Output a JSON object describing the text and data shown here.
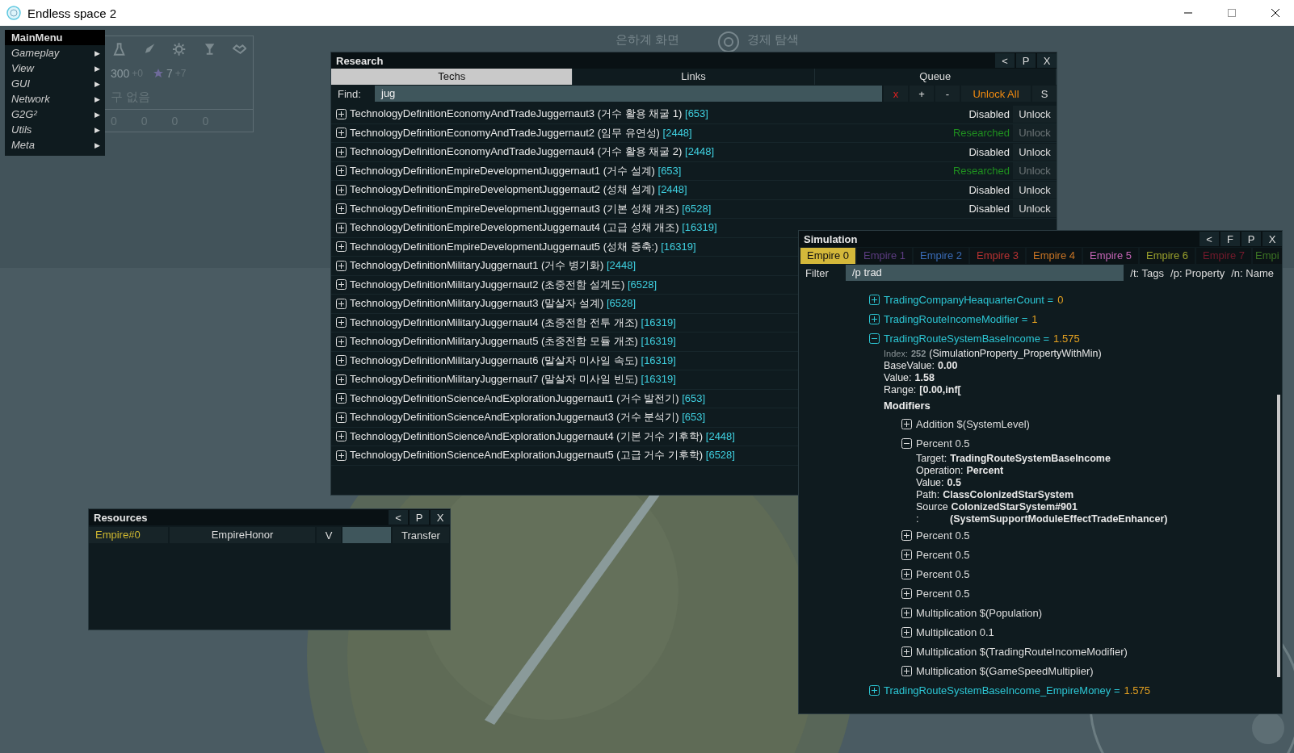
{
  "window": {
    "title": "Endless space 2"
  },
  "game_hud": {
    "tabs": [
      "은하계 화면",
      "경제 탐색"
    ],
    "stats": [
      {
        "value": "300",
        "delta": "+0"
      },
      {
        "value": "7",
        "delta": "+7"
      }
    ],
    "note": "구 없음",
    "counters": [
      "0",
      "0",
      "0",
      "0"
    ]
  },
  "main_menu": {
    "title": "MainMenu",
    "items": [
      {
        "label": "Gameplay",
        "arrow": "▶"
      },
      {
        "label": "View",
        "arrow": "▶"
      },
      {
        "label": "GUI",
        "arrow": "▶"
      },
      {
        "label": "Network",
        "arrow": "▶"
      },
      {
        "label": "G2G²",
        "arrow": "▶"
      },
      {
        "label": "Utils",
        "arrow": "▶"
      },
      {
        "label": "Meta",
        "arrow": "▶"
      }
    ]
  },
  "research": {
    "title": "Research",
    "header_buttons": [
      "<",
      "P",
      "X"
    ],
    "tabs": [
      {
        "label": "Techs",
        "selected": true
      },
      {
        "label": "Links",
        "selected": false
      },
      {
        "label": "Queue",
        "selected": false
      }
    ],
    "find": {
      "label": "Find:",
      "value": "jug",
      "buttons": [
        {
          "label": "x",
          "kind": "clear"
        },
        {
          "label": "+",
          "kind": "plain"
        },
        {
          "label": "-",
          "kind": "plain"
        },
        {
          "label": "Unlock All",
          "kind": "accent"
        },
        {
          "label": "S",
          "kind": "plain"
        }
      ]
    },
    "rows": [
      {
        "name": "TechnologyDefinitionEconomyAndTradeJuggernaut3 (거수 활용 채굴 1)",
        "cost": "[653]",
        "status": "Disabled",
        "researched": false,
        "action": "Unlock"
      },
      {
        "name": "TechnologyDefinitionEconomyAndTradeJuggernaut2 (임무 유연성)",
        "cost": "[2448]",
        "status": "Researched",
        "researched": true,
        "action": "Unlock"
      },
      {
        "name": "TechnologyDefinitionEconomyAndTradeJuggernaut4 (거수 활용 채굴 2)",
        "cost": "[2448]",
        "status": "Disabled",
        "researched": false,
        "action": "Unlock"
      },
      {
        "name": "TechnologyDefinitionEmpireDevelopmentJuggernaut1 (거수 설계)",
        "cost": "[653]",
        "status": "Researched",
        "researched": true,
        "action": "Unlock"
      },
      {
        "name": "TechnologyDefinitionEmpireDevelopmentJuggernaut2 (성채 설계)",
        "cost": "[2448]",
        "status": "Disabled",
        "researched": false,
        "action": "Unlock"
      },
      {
        "name": "TechnologyDefinitionEmpireDevelopmentJuggernaut3 (기본 성채 개조)",
        "cost": "[6528]",
        "status": "Disabled",
        "researched": false,
        "action": "Unlock"
      },
      {
        "name": "TechnologyDefinitionEmpireDevelopmentJuggernaut4 (고급 성채 개조)",
        "cost": "[16319]"
      },
      {
        "name": "TechnologyDefinitionEmpireDevelopmentJuggernaut5 (성채 증축:)",
        "cost": "[16319]"
      },
      {
        "name": "TechnologyDefinitionMilitaryJuggernaut1 (거수 병기화)",
        "cost": "[2448]"
      },
      {
        "name": "TechnologyDefinitionMilitaryJuggernaut2 (초중전함 설계도)",
        "cost": "[6528]"
      },
      {
        "name": "TechnologyDefinitionMilitaryJuggernaut3 (말살자 설계)",
        "cost": "[6528]"
      },
      {
        "name": "TechnologyDefinitionMilitaryJuggernaut4 (초중전함 전투 개조)",
        "cost": "[16319]"
      },
      {
        "name": "TechnologyDefinitionMilitaryJuggernaut5 (초중전함 모듈 개조)",
        "cost": "[16319]"
      },
      {
        "name": "TechnologyDefinitionMilitaryJuggernaut6 (말살자 미사일 속도)",
        "cost": "[16319]"
      },
      {
        "name": "TechnologyDefinitionMilitaryJuggernaut7 (말살자 미사일 빈도)",
        "cost": "[16319]"
      },
      {
        "name": "TechnologyDefinitionScienceAndExplorationJuggernaut1 (거수 발전기)",
        "cost": "[653]"
      },
      {
        "name": "TechnologyDefinitionScienceAndExplorationJuggernaut3 (거수 분석기)",
        "cost": "[653]"
      },
      {
        "name": "TechnologyDefinitionScienceAndExplorationJuggernaut4 (기본 거수 기후학)",
        "cost": "[2448]"
      },
      {
        "name": "TechnologyDefinitionScienceAndExplorationJuggernaut5 (고급 거수 기후학)",
        "cost": "[6528]"
      }
    ]
  },
  "resources": {
    "title": "Resources",
    "header_buttons": [
      "<",
      "P",
      "X"
    ],
    "empire": "Empire#0",
    "resource": "EmpireHonor",
    "toggle": "V",
    "action": "Transfer"
  },
  "simulation": {
    "title": "Simulation",
    "header_buttons": [
      "<",
      "F",
      "P",
      "X"
    ],
    "tabs": [
      {
        "label": "Empire 0",
        "selected": true,
        "color": "#d4b83a"
      },
      {
        "label": "Empire 1",
        "selected": false,
        "color": "#5c3c80"
      },
      {
        "label": "Empire 2",
        "selected": false,
        "color": "#3a6cb8"
      },
      {
        "label": "Empire 3",
        "selected": false,
        "color": "#b83232"
      },
      {
        "label": "Empire 4",
        "selected": false,
        "color": "#c87424"
      },
      {
        "label": "Empire 5",
        "selected": false,
        "color": "#c464b4"
      },
      {
        "label": "Empire 6",
        "selected": false,
        "color": "#9aa02c"
      },
      {
        "label": "Empire 7",
        "selected": false,
        "color": "#741a2c"
      },
      {
        "label": "Empi",
        "selected": false,
        "color": "#3c7424"
      }
    ],
    "filter": {
      "label": "Filter",
      "value": "/p trad",
      "hints": [
        "/t: Tags",
        "/p: Property",
        "/n: Name"
      ]
    },
    "properties": [
      {
        "name": "TradingCompanyHeaquarterCount =",
        "value": "0",
        "expanded": false
      },
      {
        "name": "TradingRouteIncomeModifier =",
        "value": "1",
        "expanded": false
      },
      {
        "name": "TradingRouteSystemBaseIncome =",
        "value": "1.575",
        "expanded": true,
        "index_label": "Index:",
        "index": "252",
        "type": "(SimulationProperty_PropertyWithMin)",
        "fields": [
          {
            "label": "BaseValue:",
            "value": "0.00"
          },
          {
            "label": "Value:",
            "value": "1.58"
          },
          {
            "label": "Range:",
            "value": "[0.00,inf["
          }
        ],
        "modifiers_title": "Modifiers",
        "modifiers": [
          {
            "label": "Addition $(SystemLevel)",
            "expanded": false
          },
          {
            "label": "Percent 0.5",
            "expanded": true,
            "fields": [
              {
                "label": "Target:",
                "value": "TradingRouteSystemBaseIncome"
              },
              {
                "label": "Operation:",
                "value": "Percent"
              },
              {
                "label": "Value:",
                "value": "0.5"
              },
              {
                "label": "Path:",
                "value": "ClassColonizedStarSystem"
              },
              {
                "label": "Source",
                "value": "ColonizedStarSystem#901"
              },
              {
                "label": ":",
                "value": "(SystemSupportModuleEffectTradeEnhancer)"
              }
            ]
          },
          {
            "label": "Percent 0.5",
            "expanded": false
          },
          {
            "label": "Percent 0.5",
            "expanded": false
          },
          {
            "label": "Percent 0.5",
            "expanded": false
          },
          {
            "label": "Percent 0.5",
            "expanded": false
          },
          {
            "label": "Multiplication $(Population)",
            "expanded": false
          },
          {
            "label": "Multiplication 0.1",
            "expanded": false
          },
          {
            "label": "Multiplication $(TradingRouteIncomeModifier)",
            "expanded": false
          },
          {
            "label": "Multiplication $(GameSpeedMultiplier)",
            "expanded": false
          }
        ]
      },
      {
        "name": "TradingRouteSystemBaseIncome_EmpireMoney =",
        "value": "1.575",
        "expanded": false
      }
    ]
  }
}
